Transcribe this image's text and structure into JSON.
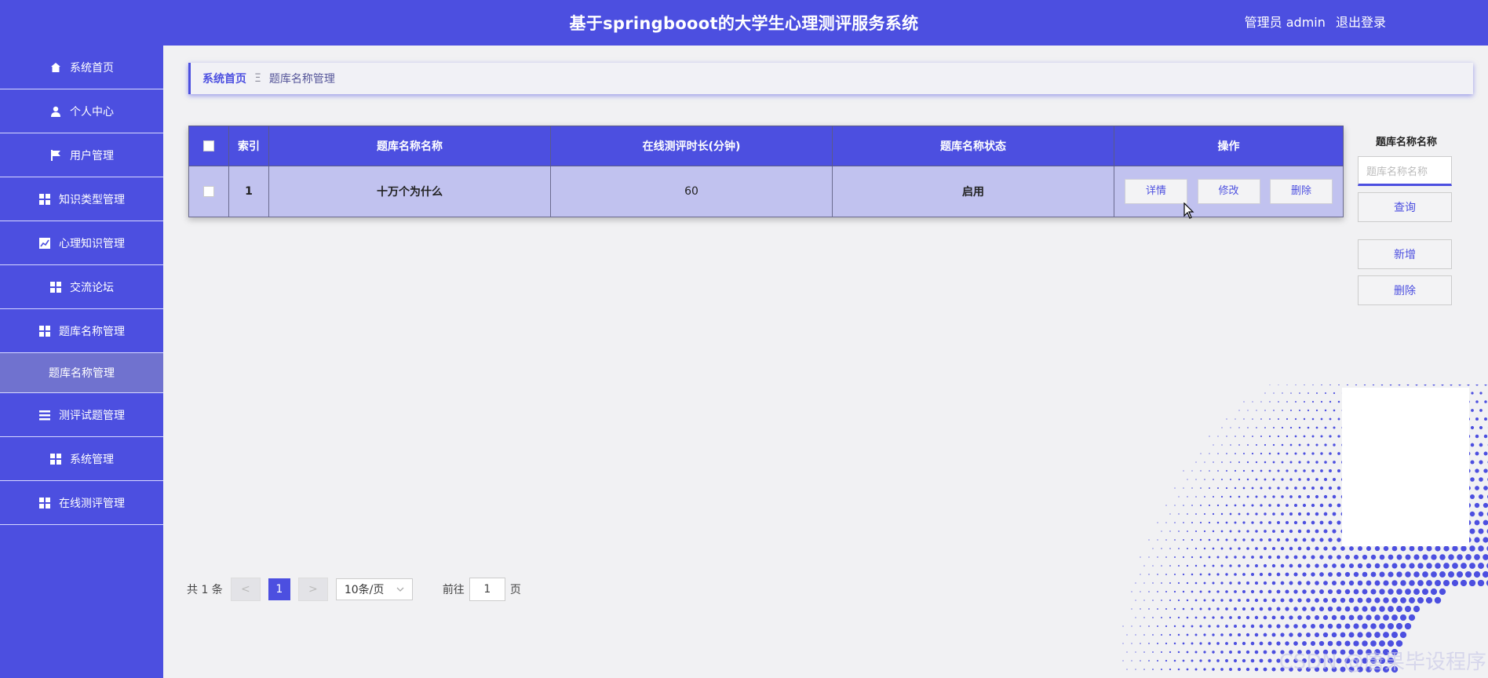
{
  "header": {
    "title": "基于springbooot的大学生心理测评服务系统",
    "user_label": "管理员 admin",
    "logout_label": "退出登录"
  },
  "sidebar": {
    "items": [
      {
        "label": "系统首页",
        "icon": "home-icon"
      },
      {
        "label": "个人中心",
        "icon": "user-icon"
      },
      {
        "label": "用户管理",
        "icon": "flag-icon"
      },
      {
        "label": "知识类型管理",
        "icon": "grid-icon"
      },
      {
        "label": "心理知识管理",
        "icon": "chart-icon"
      },
      {
        "label": "交流论坛",
        "icon": "grid-icon"
      },
      {
        "label": "题库名称管理",
        "icon": "grid-icon"
      },
      {
        "label": "题库名称管理",
        "icon": "",
        "active": true
      },
      {
        "label": "测评试题管理",
        "icon": "list-icon"
      },
      {
        "label": "系统管理",
        "icon": "grid-icon"
      },
      {
        "label": "在线测评管理",
        "icon": "grid-icon"
      }
    ]
  },
  "breadcrumb": {
    "home": "系统首页",
    "separator": "Ξ",
    "current": "题库名称管理"
  },
  "table": {
    "headers": [
      "索引",
      "题库名称名称",
      "在线测评时长(分钟)",
      "题库名称状态",
      "操作"
    ],
    "rows": [
      {
        "index": "1",
        "name": "十万个为什么",
        "duration": "60",
        "status": "启用"
      }
    ],
    "actions": [
      "详情",
      "修改",
      "删除"
    ]
  },
  "filter": {
    "label": "题库名称名称",
    "placeholder": "题库名称名称",
    "query_label": "查询",
    "add_label": "新增",
    "delete_label": "删除"
  },
  "pagination": {
    "total": "共 1 条",
    "prev": "<",
    "page": "1",
    "next": ">",
    "page_size": "10条/页",
    "goto_prefix": "前往",
    "goto_value": "1",
    "goto_suffix": "页"
  },
  "watermark": "CSDN @唐果毕设程序",
  "colors": {
    "primary": "#4c4fe0",
    "row_bg": "#c1c2ef",
    "background": "#f1f1f3"
  }
}
